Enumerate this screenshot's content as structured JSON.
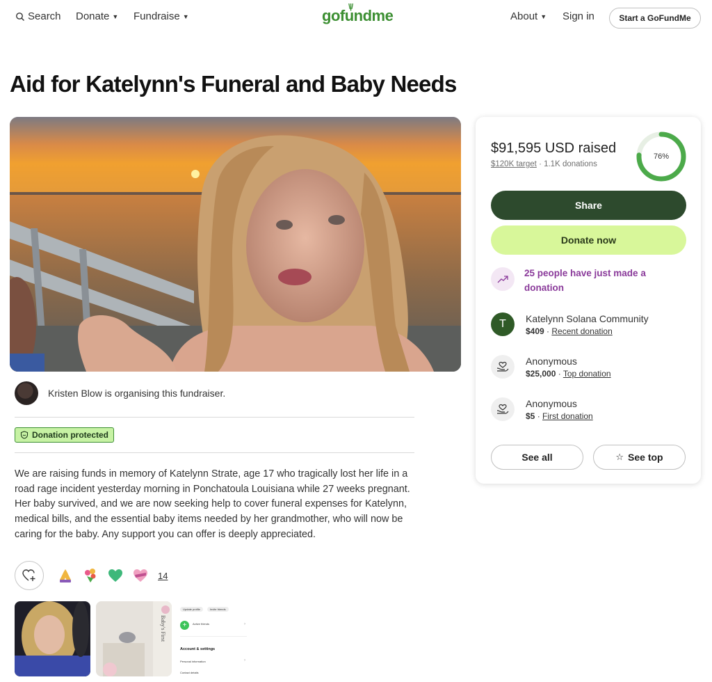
{
  "header": {
    "search_label": "Search",
    "donate_label": "Donate",
    "fundraise_label": "Fundraise",
    "logo_text": "gofundme",
    "about_label": "About",
    "signin_label": "Sign in",
    "start_label": "Start a GoFundMe"
  },
  "title": "Aid for Katelynn's Funeral and Baby Needs",
  "organiser": {
    "text": "Kristen Blow is organising this fundraiser."
  },
  "badge": {
    "label": "Donation protected"
  },
  "story": "We are raising funds in memory of Katelynn Strate, age 17 who tragically lost her life in a road rage incident yesterday morning in Ponchatoula Louisiana while 27 weeks pregnant. Her baby survived, and we are now seeking help to cover funeral expenses for Katelynn, medical bills, and the essential baby items needed by her grandmother, who will now be caring for the baby. Any support you can offer is deeply appreciated.",
  "reactions": {
    "count": "14",
    "icons": [
      "praying-hands-icon",
      "bouquet-icon",
      "green-heart-icon",
      "heart-ribbon-icon"
    ]
  },
  "thumb3": {
    "pill1": "Update profile",
    "pill2": "Invite friends",
    "row_title": "Active friends",
    "section": "Account & settings",
    "item1": "Personal information",
    "item2": "Contact details"
  },
  "card": {
    "raised": "$91,595 USD raised",
    "target": "$120K target",
    "donations": "1.1K donations",
    "percent_label": "76%",
    "progress": 0.76,
    "share_label": "Share",
    "donate_label": "Donate now",
    "trend_text": "25 people have just made a donation",
    "donors": [
      {
        "initial": "T",
        "name": "Katelynn Solana Community",
        "amount": "$409",
        "kind": "Recent donation"
      },
      {
        "initial": "",
        "name": "Anonymous",
        "amount": "$25,000",
        "kind": "Top donation"
      },
      {
        "initial": "",
        "name": "Anonymous",
        "amount": "$5",
        "kind": "First donation"
      }
    ],
    "see_all_label": "See all",
    "see_top_label": "See top"
  },
  "colors": {
    "brand_green": "#3c8f32",
    "share_bg": "#2d4a2d",
    "donate_bg": "#d8f79a",
    "trend_purple": "#8a3a9a"
  }
}
